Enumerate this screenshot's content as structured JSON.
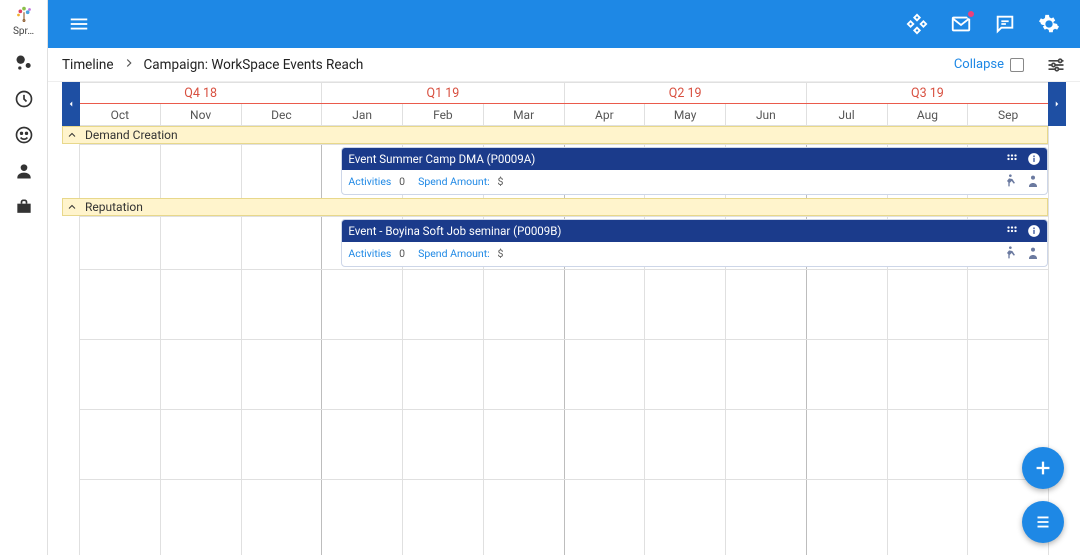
{
  "brand_label": "Spr…",
  "header": {
    "collapse_label": "Collapse"
  },
  "crumb": {
    "root": "Timeline",
    "page": "Campaign: WorkSpace Events Reach"
  },
  "timeline": {
    "quarters": [
      "Q4 18",
      "Q1 19",
      "Q2 19",
      "Q3 19"
    ],
    "months": [
      "Oct",
      "Nov",
      "Dec",
      "Jan",
      "Feb",
      "Mar",
      "Apr",
      "May",
      "Jun",
      "Jul",
      "Aug",
      "Sep"
    ]
  },
  "groups": [
    {
      "label": "Demand Creation"
    },
    {
      "label": "Reputation"
    }
  ],
  "events": [
    {
      "title": "Event Summer Camp DMA (P0009A)",
      "activities_label": "Activities",
      "activities_value": "0",
      "spend_label": "Spend Amount:",
      "spend_value": "$"
    },
    {
      "title": "Event - Boyina Soft Job seminar (P0009B)",
      "activities_label": "Activities",
      "activities_value": "0",
      "spend_label": "Spend Amount:",
      "spend_value": "$"
    }
  ]
}
